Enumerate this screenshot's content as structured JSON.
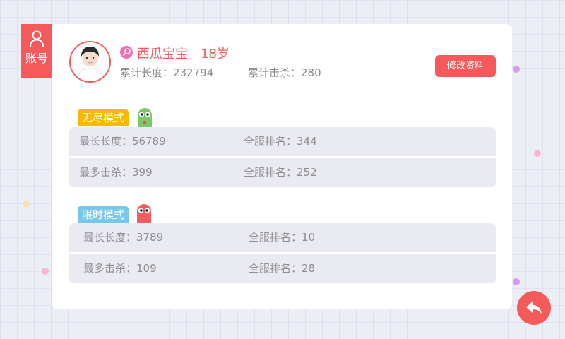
{
  "account_tab": {
    "label": "账号",
    "icon": "user-icon"
  },
  "profile": {
    "nickname": "西瓜宝宝",
    "age": "18岁",
    "total_length_label": "累计长度：",
    "total_length": "232794",
    "total_kills_label": "累计击杀：",
    "total_kills": "280",
    "edit_button": "修改资料"
  },
  "endless_mode": {
    "title": "无尽模式",
    "tag_color": "#f6b800",
    "rows": [
      {
        "label": "最长长度：",
        "value": "56789",
        "rank_label": "全服排名：",
        "rank": "344"
      },
      {
        "label": "最多击杀：",
        "value": "399",
        "rank_label": "全服排名：",
        "rank": "252"
      }
    ]
  },
  "timed_mode": {
    "title": "限时模式",
    "tag_color": "#78c7e8",
    "rows": [
      {
        "label": "最长长度：",
        "value": "3789",
        "rank_label": "全服排名：",
        "rank": "10"
      },
      {
        "label": "最多击杀：",
        "value": "109",
        "rank_label": "全服排名：",
        "rank": "28"
      }
    ]
  },
  "colors": {
    "accent": "#f45a5a",
    "panel": "#e9eaf2",
    "text_muted": "#8e8e8e"
  },
  "back_button": {
    "icon": "back-arrow-icon"
  }
}
